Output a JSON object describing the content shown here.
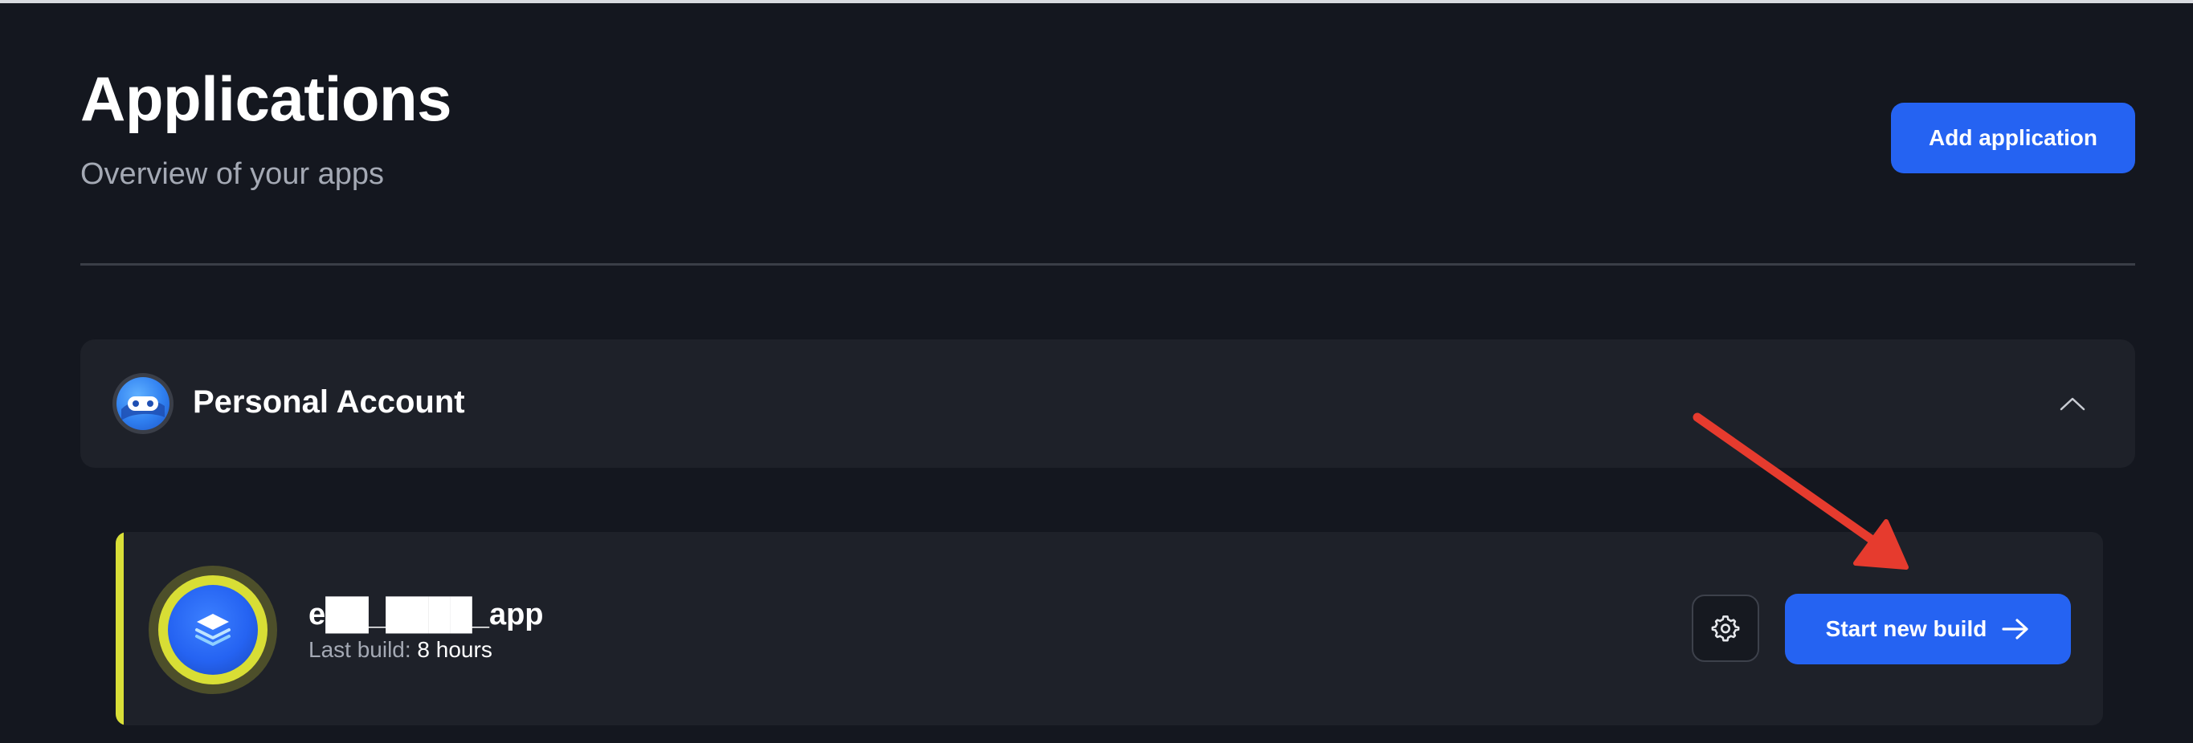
{
  "header": {
    "title": "Applications",
    "subtitle": "Overview of your apps",
    "add_button_label": "Add application"
  },
  "account": {
    "name": "Personal Account",
    "avatar_icon": "robot-face-icon",
    "toggle_icon": "chevron-up-icon"
  },
  "app": {
    "name": "e██_████_app",
    "last_build_label": "Last build:",
    "last_build_value": "8 hours",
    "icon": "layers-stack-icon",
    "settings_icon": "gear-icon",
    "start_build_label": "Start new build",
    "start_build_icon": "arrow-right-icon",
    "accent_color": "#d9df38"
  },
  "colors": {
    "background": "#14171f",
    "panel": "#1e2129",
    "primary": "#2563f2",
    "annotation_arrow": "#e63b2e"
  }
}
